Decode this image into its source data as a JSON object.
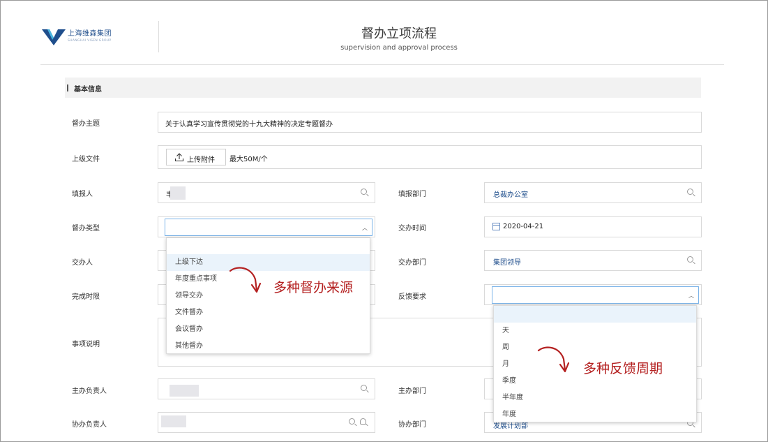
{
  "logo": {
    "name_cn": "上海维森集团",
    "name_en": "SHANGHAI VISEN GROUP"
  },
  "header": {
    "title": "督办立项流程",
    "subtitle": "supervision and approval process"
  },
  "section": {
    "title": "基本信息"
  },
  "fields": {
    "topic": {
      "label": "督办主题",
      "value": "关于认真学习宣传贯彻党的十九大精神的决定专题督办"
    },
    "file": {
      "label": "上级文件",
      "button": "上传附件",
      "note": "最大50M/个"
    },
    "reporter": {
      "label": "填报人",
      "value": "丰"
    },
    "report_dept": {
      "label": "填报部门",
      "value": "总裁办公室"
    },
    "type": {
      "label": "督办类型"
    },
    "assign_time": {
      "label": "交办时间",
      "value": "2020-04-21"
    },
    "assigner": {
      "label": "交办人"
    },
    "assign_dept": {
      "label": "交办部门",
      "value": "集团领导"
    },
    "deadline": {
      "label": "完成时限"
    },
    "feedback": {
      "label": "反馈要求"
    },
    "description": {
      "label": "事项说明"
    },
    "owner": {
      "label": "主办负责人"
    },
    "owner_dept": {
      "label": "主办部门"
    },
    "co_owner": {
      "label": "协办负责人"
    },
    "co_dept": {
      "label": "协办部门",
      "value": "发展计划部"
    }
  },
  "type_dropdown": {
    "options": [
      "上级下达",
      "年度重点事项",
      "领导交办",
      "文件督办",
      "会议督办",
      "其他督办"
    ],
    "highlighted": "上级下达"
  },
  "feedback_dropdown": {
    "options": [
      "天",
      "周",
      "月",
      "季度",
      "半年度",
      "年度"
    ]
  },
  "annotations": {
    "source": "多种督办来源",
    "period": "多种反馈周期"
  },
  "colors": {
    "accent": "#1f4e8c",
    "annotation": "#b42020",
    "focus": "#7ab3e8"
  },
  "icons": [
    "logo-icon",
    "search-icon",
    "chevron-up-icon",
    "upload-icon",
    "calendar-icon",
    "contact-icon"
  ]
}
